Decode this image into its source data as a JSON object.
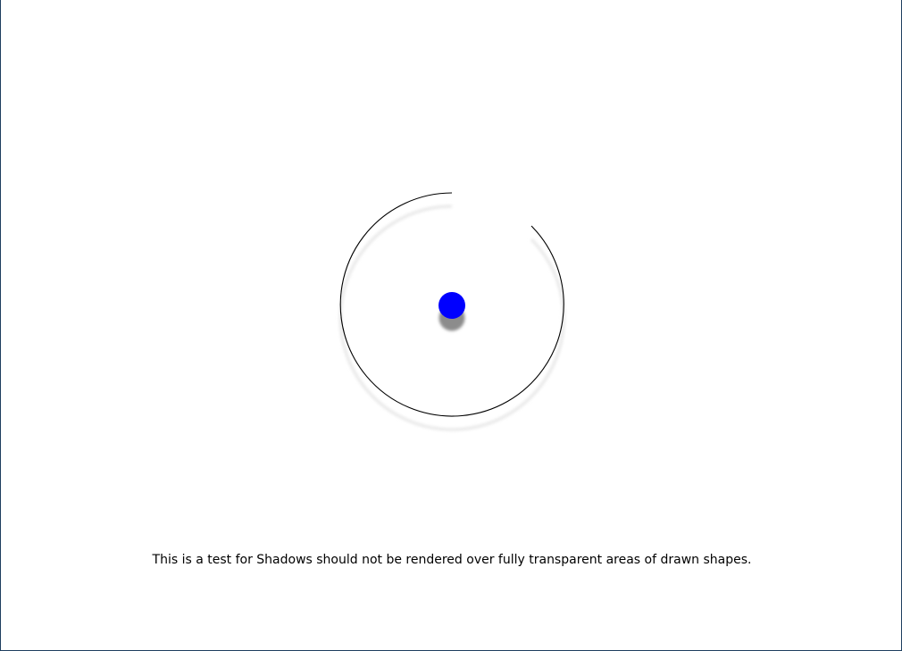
{
  "caption": {
    "text": "This is a test for Shadows should not be rendered over fully transparent areas of drawn shapes."
  },
  "scene": {
    "arc_color": "#000000",
    "arc_shadow_color": "#e6e6e6",
    "dot_color": "#0000ff",
    "dot_shadow_color": "#8c8c8c",
    "background_color": "#ffffff"
  }
}
